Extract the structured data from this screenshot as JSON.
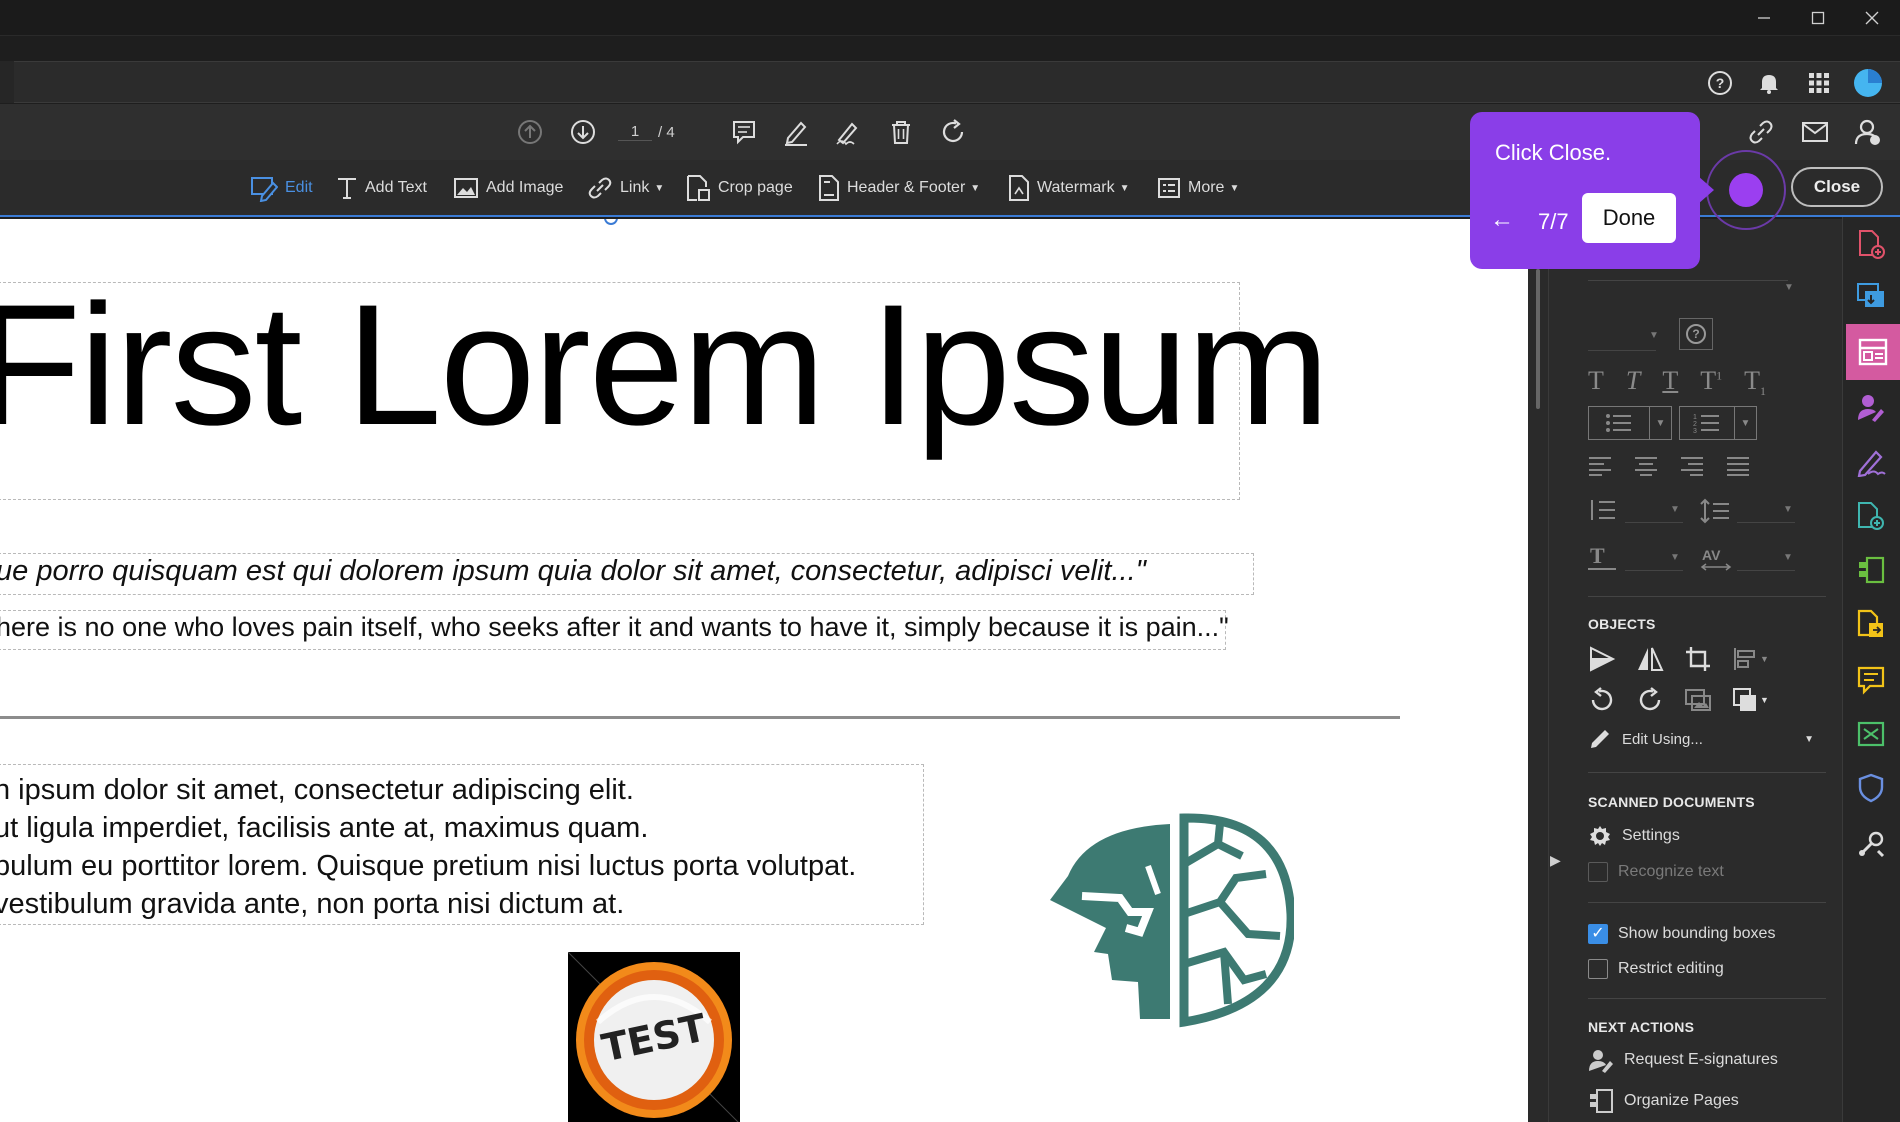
{
  "window": {
    "minimize_icon": "minimize-icon",
    "maximize_icon": "maximize-icon",
    "close_icon": "close-icon"
  },
  "toolbar": {
    "page_current": "1",
    "page_total": "/ 4",
    "tools": [
      {
        "label": "Edit"
      },
      {
        "label": "Add Text"
      },
      {
        "label": "Add Image"
      },
      {
        "label": "Link"
      },
      {
        "label": "Crop page"
      },
      {
        "label": "Header & Footer"
      },
      {
        "label": "Watermark"
      },
      {
        "label": "More"
      }
    ],
    "close_label": "Close"
  },
  "document": {
    "title": "First Lorem Ipsum",
    "quote_italic": "ue porro quisquam est qui dolorem ipsum quia dolor sit amet, consectetur, adipisci velit...\"",
    "quote_plain": "here is no one who loves pain itself, who seeks after it and wants to have it, simply because it is pain...\"",
    "paragraph_lines": [
      "n ipsum dolor sit amet, consectetur adipiscing elit.",
      "ut ligula imperdiet, facilisis ante at, maximus quam.",
      "bulum eu porttitor lorem. Quisque pretium nisi luctus porta volutpat.",
      " vestibulum gravida ante, non porta nisi dictum at."
    ],
    "badge_text": "TEST"
  },
  "tour": {
    "message": "Click Close.",
    "back_label": "←",
    "step": "7/7",
    "done_label": "Done"
  },
  "panel": {
    "objects_heading": "OBJECTS",
    "edit_using": "Edit Using...",
    "scanned_heading": "SCANNED DOCUMENTS",
    "settings_label": "Settings",
    "recognize_label": "Recognize text",
    "show_bounding_label": "Show bounding boxes",
    "show_bounding_checked": true,
    "restrict_label": "Restrict editing",
    "restrict_checked": false,
    "next_heading": "NEXT ACTIONS",
    "request_label": "Request E-signatures",
    "organize_label": "Organize Pages"
  },
  "colors": {
    "accent": "#3a7bd5",
    "tour": "#8a3ee8",
    "rail_active": "#d45aa0",
    "logo": "#3d7a72"
  }
}
